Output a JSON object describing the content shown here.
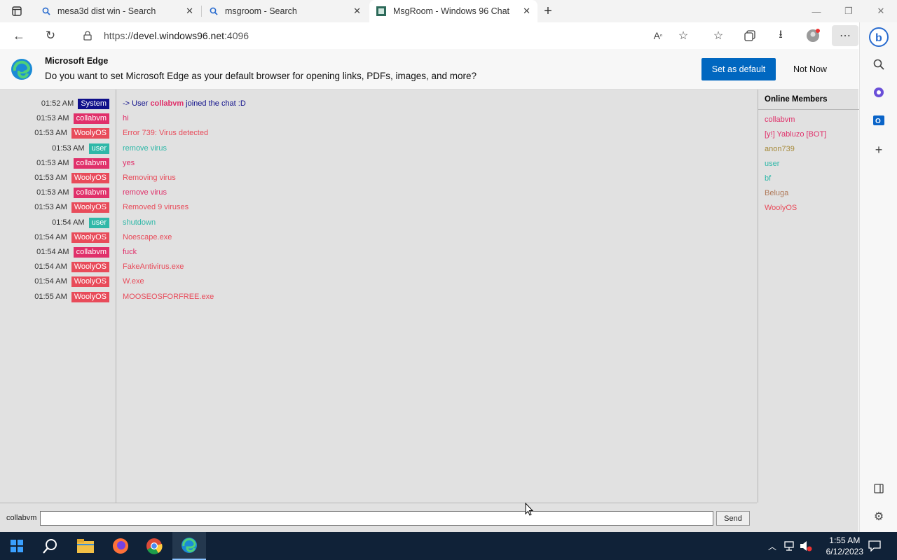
{
  "tabs": [
    {
      "title": "mesa3d dist win - Search"
    },
    {
      "title": "msgroom - Search"
    },
    {
      "title": "MsgRoom - Windows 96 Chat"
    }
  ],
  "address": {
    "scheme": "https://",
    "host": "devel.windows96.net",
    "port": ":4096"
  },
  "banner": {
    "title": "Microsoft Edge",
    "message": "Do you want to set Microsoft Edge as your default browser for opening links, PDFs, images, and more?",
    "primary": "Set as default",
    "secondary": "Not Now"
  },
  "messages": [
    {
      "time": "01:52 AM",
      "nick": "System",
      "nick_color": "#0f0f8a",
      "text": "-> User collabvm joined the chat :D",
      "text_color": "#0f0f8a",
      "system_user": "collabvm"
    },
    {
      "time": "01:53 AM",
      "nick": "collabvm",
      "nick_color": "#e0306a",
      "text": "hi",
      "text_color": "#e0306a"
    },
    {
      "time": "01:53 AM",
      "nick": "WoolyOS",
      "nick_color": "#e84b5a",
      "text": "Error 739: Virus detected",
      "text_color": "#e84b5a"
    },
    {
      "time": "01:53 AM",
      "nick": "user",
      "nick_color": "#2fb8a8",
      "text": "remove virus",
      "text_color": "#2fb8a8"
    },
    {
      "time": "01:53 AM",
      "nick": "collabvm",
      "nick_color": "#e0306a",
      "text": "yes",
      "text_color": "#e0306a"
    },
    {
      "time": "01:53 AM",
      "nick": "WoolyOS",
      "nick_color": "#e84b5a",
      "text": "Removing virus",
      "text_color": "#e84b5a"
    },
    {
      "time": "01:53 AM",
      "nick": "collabvm",
      "nick_color": "#e0306a",
      "text": "remove virus",
      "text_color": "#e0306a"
    },
    {
      "time": "01:53 AM",
      "nick": "WoolyOS",
      "nick_color": "#e84b5a",
      "text": "Removed 9 viruses",
      "text_color": "#e84b5a"
    },
    {
      "time": "01:54 AM",
      "nick": "user",
      "nick_color": "#2fb8a8",
      "text": "shutdown",
      "text_color": "#2fb8a8"
    },
    {
      "time": "01:54 AM",
      "nick": "WoolyOS",
      "nick_color": "#e84b5a",
      "text": "Noescape.exe",
      "text_color": "#e84b5a"
    },
    {
      "time": "01:54 AM",
      "nick": "collabvm",
      "nick_color": "#e0306a",
      "text": "fuck",
      "text_color": "#e0306a"
    },
    {
      "time": "01:54 AM",
      "nick": "WoolyOS",
      "nick_color": "#e84b5a",
      "text": "FakeAntivirus.exe",
      "text_color": "#e84b5a"
    },
    {
      "time": "01:54 AM",
      "nick": "WoolyOS",
      "nick_color": "#e84b5a",
      "text": "W.exe",
      "text_color": "#e84b5a"
    },
    {
      "time": "01:55 AM",
      "nick": "WoolyOS",
      "nick_color": "#e84b5a",
      "text": "MOOSEOSFORFREE.exe",
      "text_color": "#e84b5a"
    }
  ],
  "members": {
    "title": "Online Members",
    "list": [
      {
        "name": "collabvm",
        "color": "#e0306a"
      },
      {
        "name": "[y!] Yabluzo [BOT]",
        "color": "#e0306a"
      },
      {
        "name": "anon739",
        "color": "#a68a3a"
      },
      {
        "name": "user",
        "color": "#2fb8a8"
      },
      {
        "name": "bf",
        "color": "#2fb8a8"
      },
      {
        "name": "Beluga",
        "color": "#b07a5a"
      },
      {
        "name": "WoolyOS",
        "color": "#e84b5a"
      }
    ]
  },
  "input": {
    "username": "collabvm",
    "value": "",
    "send": "Send"
  },
  "clock": {
    "time": "1:55 AM",
    "date": "6/12/2023"
  }
}
